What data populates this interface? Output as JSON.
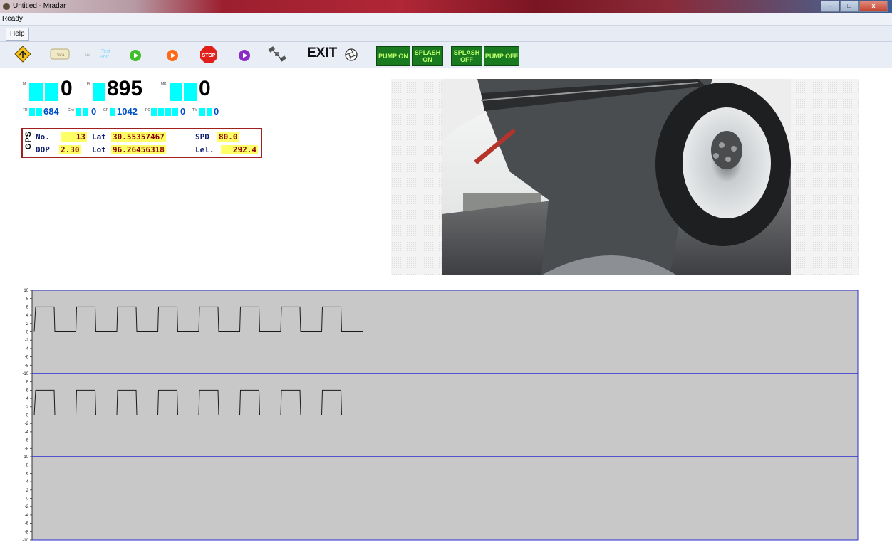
{
  "window": {
    "title": "Untitled - Mradar",
    "minimize": "–",
    "maximize": "□",
    "close": "x"
  },
  "status": {
    "text": "Ready"
  },
  "menu": {
    "help": "Help"
  },
  "toolbar": {
    "icons": [
      "navigate-icon",
      "parallel-port-icon",
      "test-port-icon",
      "play-green-icon",
      "record-orange-icon",
      "stop-icon",
      "play-purple-icon",
      "satellite-icon",
      "camera-shutter-icon"
    ],
    "stop_label": "STOP",
    "exit_label": "EXIT",
    "pump_on": "PUMP ON",
    "splash_on_1": "SPLASH",
    "splash_on_2": "ON",
    "splash_off_1": "SPLASH",
    "splash_off_2": "OFF",
    "pump_off": "PUMP OFF",
    "colors": {
      "button_bg": "#1a7a1f",
      "button_text": "#b9ff6a"
    }
  },
  "readouts": {
    "mi": {
      "label": "Mi",
      "value": "0"
    },
    "ft": {
      "label": "Ft",
      "value": "895"
    },
    "mk": {
      "label": "MK",
      "value": "0"
    },
    "tr": {
      "label": "TR",
      "value": "684"
    },
    "gnv": {
      "label": "Gnv",
      "value": "0"
    },
    "gr": {
      "label": "GR",
      "value": "1042"
    },
    "pc": {
      "label": "PC",
      "value": "0"
    },
    "tm": {
      "label": "TM",
      "value": "0"
    },
    "colors": {
      "block": "#00ffff",
      "small_value": "#0050c8"
    }
  },
  "gps": {
    "label": "GPS",
    "no_label": "No.",
    "no_value": "13",
    "lat_label": "Lat",
    "lat_value": "30.55357467",
    "spd_label": "SPD",
    "spd_value": "80.0",
    "dop_label": "DOP",
    "dop_value": "2.30",
    "lot_label": "Lot",
    "lot_value": "96.26456318",
    "lel_label": "Lel.",
    "lel_value": "292.4"
  },
  "chart_data": [
    {
      "type": "line",
      "ylim": [
        -10,
        10
      ],
      "ticks": [
        "10",
        "8",
        "6",
        "4",
        "2",
        "0",
        "-2",
        "-4",
        "-6",
        "-8",
        "-10"
      ],
      "series": [
        {
          "name": "",
          "pattern": "square-wave",
          "high": 6,
          "low": 0,
          "periods": 8
        }
      ]
    },
    {
      "type": "line",
      "ylim": [
        -10,
        10
      ],
      "ticks": [
        "8",
        "6",
        "4",
        "2",
        "0",
        "-2",
        "-4",
        "-6",
        "-8",
        "-10"
      ],
      "series": [
        {
          "name": "",
          "pattern": "square-wave",
          "high": 6,
          "low": 0,
          "periods": 8
        }
      ]
    },
    {
      "type": "line",
      "ylim": [
        -10,
        10
      ],
      "ticks": [
        "8",
        "6",
        "4",
        "2",
        "0",
        "-2",
        "-4",
        "-6",
        "-8",
        "-10"
      ],
      "series": []
    }
  ]
}
